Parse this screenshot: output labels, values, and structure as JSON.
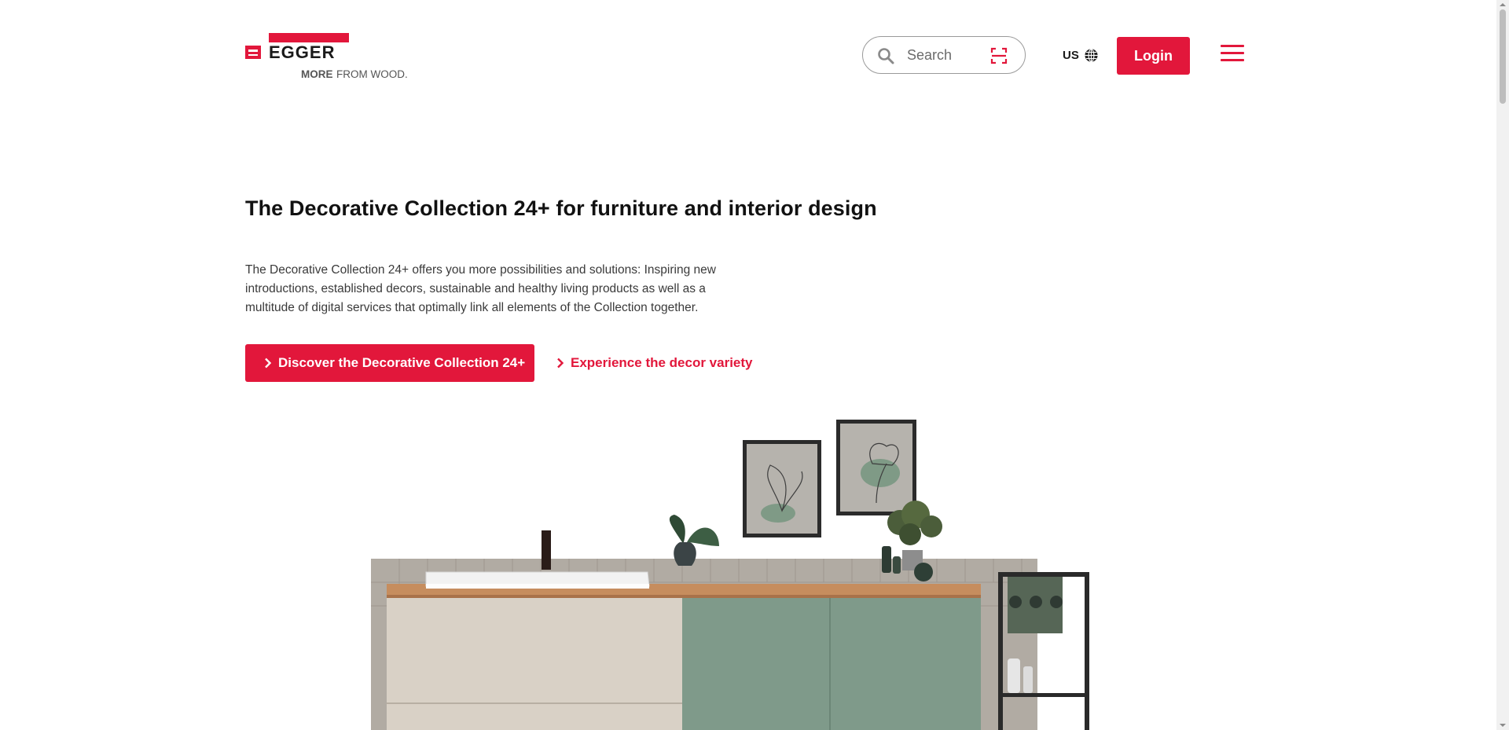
{
  "header": {
    "logo": {
      "brand": "EGGER",
      "tagline_bold": "MORE",
      "tagline_rest": "FROM WOOD."
    },
    "search": {
      "placeholder": "Search",
      "icon": "search-icon",
      "scan_icon": "scan-icon"
    },
    "locale": {
      "label": "US",
      "icon": "globe-icon"
    },
    "login_label": "Login",
    "menu_icon": "hamburger-menu-icon"
  },
  "hero": {
    "title": "The Decorative Collection 24+ for furniture and interior design",
    "description": "The Decorative Collection 24+ offers you more possibilities and solutions: Inspiring new introductions, established decors, sustainable and healthy living products as well as a multitude of digital services that optimally link all elements of the Collection together.",
    "primary_cta": "Discover the Decorative Collection 24+",
    "secondary_cta": "Experience the decor variety",
    "image_subject": "Bathroom vanity with beige and sage green fronts, wooden worktop, white basin, framed floral prints and plants"
  },
  "colors": {
    "accent": "#e2173b",
    "text": "#111111",
    "body_text": "#3a3a3a",
    "beige_front": "#d9d1c6",
    "green_front": "#7f9a8a",
    "worktop": "#c68d5e"
  }
}
